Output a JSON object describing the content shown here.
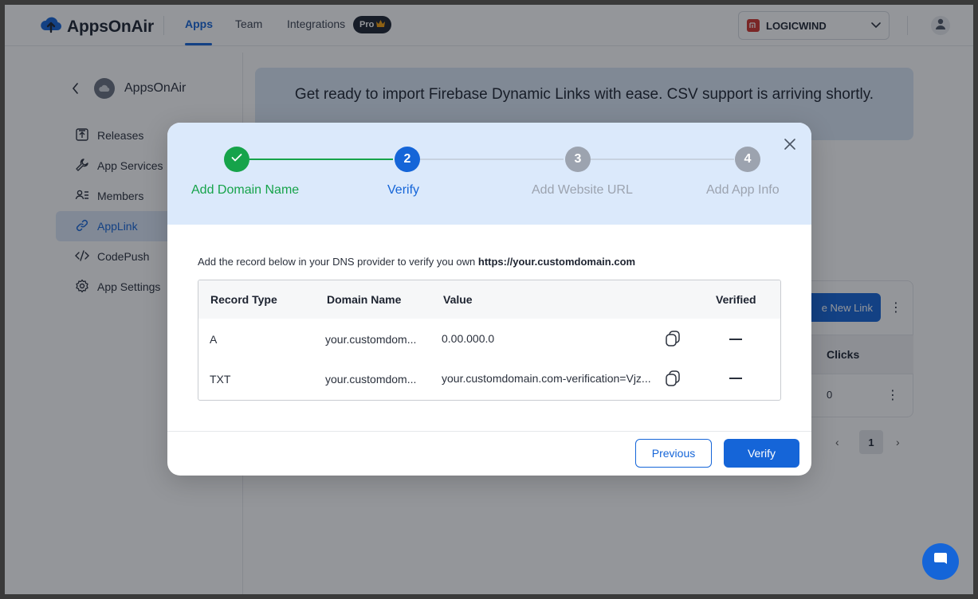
{
  "app": {
    "name": "AppsOnAir",
    "logo_icon": "cloud-upload-icon"
  },
  "topnav": {
    "tabs": [
      {
        "label": "Apps",
        "active": true
      },
      {
        "label": "Team",
        "active": false
      },
      {
        "label": "Integrations",
        "active": false
      }
    ],
    "pro_badge": "Pro",
    "organization": {
      "name": "LOGICWIND",
      "icon": "organization-logo-icon",
      "brand_color": "#d0342c"
    },
    "user_icon": "user-icon"
  },
  "sidebar": {
    "app_name": "AppsOnAir",
    "items": [
      {
        "label": "Releases",
        "icon": "releases-icon",
        "active": false
      },
      {
        "label": "App Services",
        "icon": "wrench-icon",
        "active": false
      },
      {
        "label": "Members",
        "icon": "members-icon",
        "active": false
      },
      {
        "label": "AppLink",
        "icon": "link-icon",
        "active": true
      },
      {
        "label": "CodePush",
        "icon": "code-icon",
        "active": false
      },
      {
        "label": "App Settings",
        "icon": "gear-icon",
        "active": false
      }
    ]
  },
  "main": {
    "banner_text": "Get ready to import Firebase Dynamic Links with ease. CSV support is arriving shortly.",
    "create_button_partial": "e New Link",
    "clicks_header": "Clicks",
    "clicks_value": "0",
    "pagination": {
      "current_page": "1"
    }
  },
  "modal": {
    "steps": [
      {
        "number": "1",
        "label": "Add Domain Name",
        "status": "completed"
      },
      {
        "number": "2",
        "label": "Verify",
        "status": "active"
      },
      {
        "number": "3",
        "label": "Add Website URL",
        "status": "pending"
      },
      {
        "number": "4",
        "label": "Add App Info",
        "status": "pending"
      }
    ],
    "description_prefix": "Add the record below in your DNS provider to verify you own ",
    "description_domain": "https://your.customdomain.com",
    "table": {
      "headers": [
        "Record Type",
        "Domain Name",
        "Value",
        "Verified"
      ],
      "rows": [
        {
          "record_type": "A",
          "domain_name": "your.customdom...",
          "value": "0.00.000.0",
          "verified": "—"
        },
        {
          "record_type": "TXT",
          "domain_name": "your.customdom...",
          "value": "your.customdomain.com-verification=Vjz...",
          "verified": "—"
        }
      ]
    },
    "buttons": {
      "previous": "Previous",
      "verify": "Verify"
    }
  },
  "colors": {
    "accent": "#1565d8",
    "success": "#16a34a",
    "pending": "#9ca3af",
    "modal_header_bg": "#dbe9fb"
  }
}
